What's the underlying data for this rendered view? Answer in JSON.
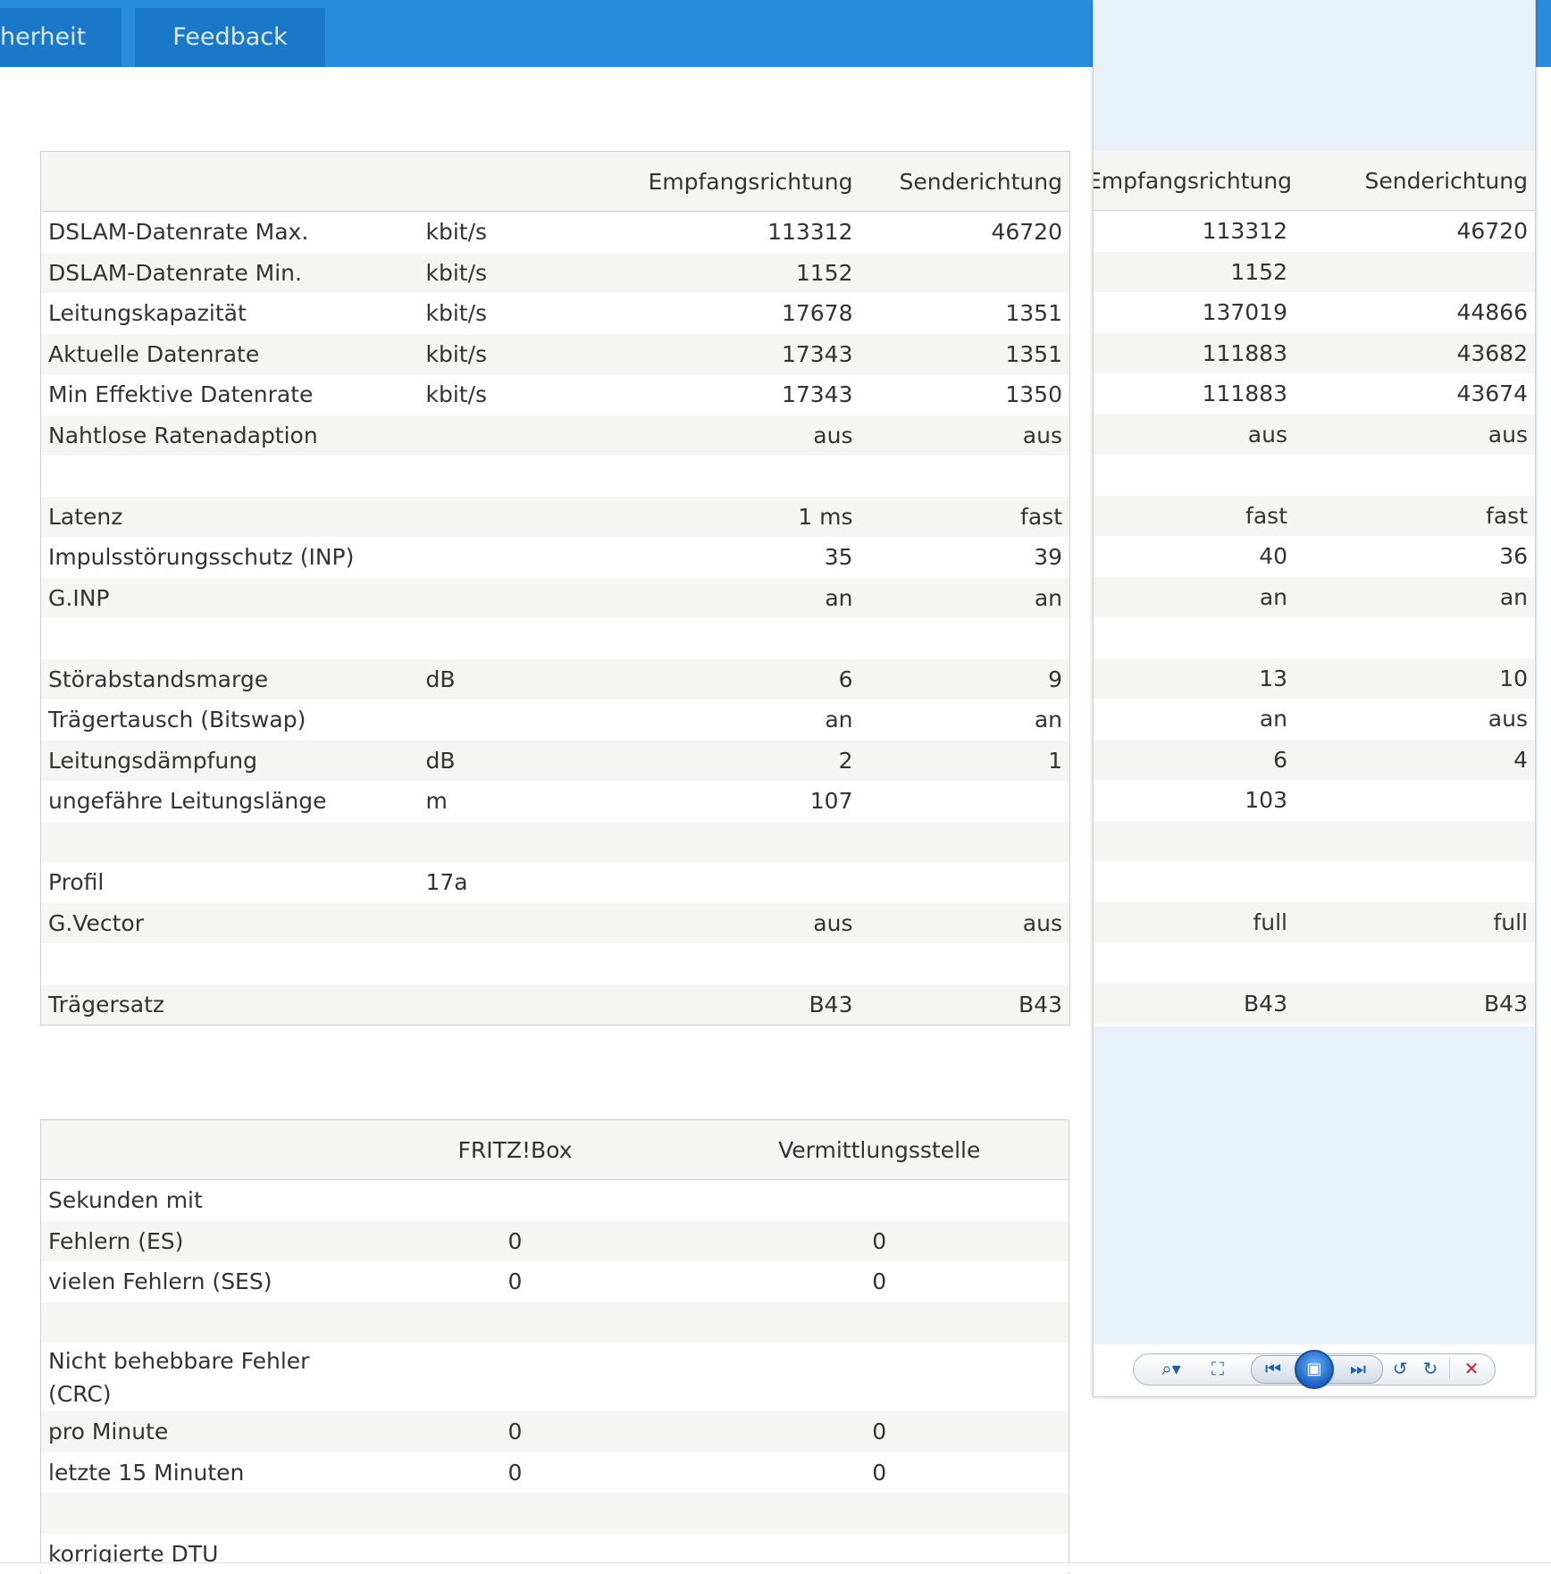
{
  "topbar": {
    "tabs": [
      {
        "label": "herheit"
      },
      {
        "label": "Feedback"
      }
    ]
  },
  "main_table": {
    "headers": [
      "",
      "",
      "Empfangsrichtung",
      "Senderichtung"
    ],
    "rows": [
      {
        "label": "DSLAM-Datenrate Max.",
        "unit": "kbit/s",
        "rx": "113312",
        "tx": "46720"
      },
      {
        "label": "DSLAM-Datenrate Min.",
        "unit": "kbit/s",
        "rx": "1152",
        "tx": ""
      },
      {
        "label": "Leitungskapazität",
        "unit": "kbit/s",
        "rx": "17678",
        "tx": "1351"
      },
      {
        "label": "Aktuelle Datenrate",
        "unit": "kbit/s",
        "rx": "17343",
        "tx": "1351"
      },
      {
        "label": "Min Effektive Datenrate",
        "unit": "kbit/s",
        "rx": "17343",
        "tx": "1350"
      },
      {
        "label": "Nahtlose Ratenadaption",
        "unit": "",
        "rx": "aus",
        "tx": "aus"
      },
      {
        "label": "",
        "unit": "",
        "rx": "",
        "tx": ""
      },
      {
        "label": "Latenz",
        "unit": "",
        "rx": "1 ms",
        "tx": "fast"
      },
      {
        "label": "Impulsstörungsschutz (INP)",
        "unit": "",
        "rx": "35",
        "tx": "39"
      },
      {
        "label": "G.INP",
        "unit": "",
        "rx": "an",
        "tx": "an"
      },
      {
        "label": "",
        "unit": "",
        "rx": "",
        "tx": ""
      },
      {
        "label": "Störabstandsmarge",
        "unit": "dB",
        "rx": "6",
        "tx": "9"
      },
      {
        "label": "Trägertausch (Bitswap)",
        "unit": "",
        "rx": "an",
        "tx": "an"
      },
      {
        "label": "Leitungsdämpfung",
        "unit": "dB",
        "rx": "2",
        "tx": "1"
      },
      {
        "label": "ungefähre Leitungslänge",
        "unit": "m",
        "rx": "107",
        "tx": ""
      },
      {
        "label": "",
        "unit": "",
        "rx": "",
        "tx": ""
      },
      {
        "label": "Profil",
        "unit": "17a",
        "rx": "",
        "tx": ""
      },
      {
        "label": "G.Vector",
        "unit": "",
        "rx": "aus",
        "tx": "aus"
      },
      {
        "label": "",
        "unit": "",
        "rx": "",
        "tx": ""
      },
      {
        "label": "Trägersatz",
        "unit": "",
        "rx": "B43",
        "tx": "B43"
      }
    ]
  },
  "popup_table": {
    "headers": [
      "Empfangsrichtung",
      "Senderichtung"
    ],
    "rows": [
      {
        "rx": "113312",
        "tx": "46720"
      },
      {
        "rx": "1152",
        "tx": ""
      },
      {
        "rx": "137019",
        "tx": "44866"
      },
      {
        "rx": "111883",
        "tx": "43682"
      },
      {
        "rx": "111883",
        "tx": "43674"
      },
      {
        "rx": "aus",
        "tx": "aus"
      },
      {
        "rx": "",
        "tx": ""
      },
      {
        "rx": "fast",
        "tx": "fast"
      },
      {
        "rx": "40",
        "tx": "36"
      },
      {
        "rx": "an",
        "tx": "an"
      },
      {
        "rx": "",
        "tx": ""
      },
      {
        "rx": "13",
        "tx": "10"
      },
      {
        "rx": "an",
        "tx": "aus"
      },
      {
        "rx": "6",
        "tx": "4"
      },
      {
        "rx": "103",
        "tx": ""
      },
      {
        "rx": "",
        "tx": ""
      },
      {
        "rx": "",
        "tx": ""
      },
      {
        "rx": "full",
        "tx": "full"
      },
      {
        "rx": "",
        "tx": ""
      },
      {
        "rx": "B43",
        "tx": "B43"
      }
    ]
  },
  "viewer_toolbar": {
    "icons": [
      "zoom-icon",
      "fit-icon",
      "previous-icon",
      "slideshow-icon",
      "next-icon",
      "rotate-left-icon",
      "rotate-right-icon",
      "delete-icon"
    ]
  },
  "stats_table": {
    "headers": [
      "",
      "FRITZ!Box",
      "Vermittlungsstelle"
    ],
    "rows": [
      {
        "label": "Sekunden mit",
        "fritz": "",
        "vst": ""
      },
      {
        "label": "Fehlern (ES)",
        "fritz": "0",
        "vst": "0"
      },
      {
        "label": "vielen Fehlern (SES)",
        "fritz": "0",
        "vst": "0"
      },
      {
        "label": "",
        "fritz": "",
        "vst": ""
      },
      {
        "label": "Nicht behebbare Fehler (CRC)",
        "fritz": "",
        "vst": ""
      },
      {
        "label": "pro Minute",
        "fritz": "0",
        "vst": "0"
      },
      {
        "label": "letzte 15 Minuten",
        "fritz": "0",
        "vst": "0"
      },
      {
        "label": "",
        "fritz": "",
        "vst": ""
      },
      {
        "label": "korrigierte DTU",
        "fritz": "",
        "vst": ""
      }
    ]
  }
}
